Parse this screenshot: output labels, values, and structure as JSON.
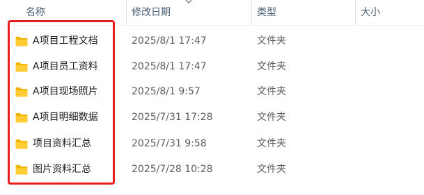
{
  "columns": {
    "name": "名称",
    "date_modified": "修改日期",
    "type": "类型",
    "size": "大小"
  },
  "files": [
    {
      "name": "A项目工程文档",
      "date": "2025/8/1 17:47",
      "type": "文件夹",
      "icon": "folder-icon"
    },
    {
      "name": "A项目员工资料",
      "date": "2025/8/1 17:47",
      "type": "文件夹",
      "icon": "folder-icon"
    },
    {
      "name": "A项目现场照片",
      "date": "2025/8/1 9:57",
      "type": "文件夹",
      "icon": "folder-icon"
    },
    {
      "name": "A项目明细数据",
      "date": "2025/7/31 17:28",
      "type": "文件夹",
      "icon": "folder-icon"
    },
    {
      "name": "项目资料汇总",
      "date": "2025/7/31 9:58",
      "type": "文件夹",
      "icon": "folder-icon"
    },
    {
      "name": "图片资料汇总",
      "date": "2025/7/28 10:28",
      "type": "文件夹",
      "icon": "folder-icon"
    }
  ],
  "colors": {
    "highlight": "#e81d1d",
    "folder_body": "#ffcc33",
    "folder_tab": "#f0b400"
  }
}
